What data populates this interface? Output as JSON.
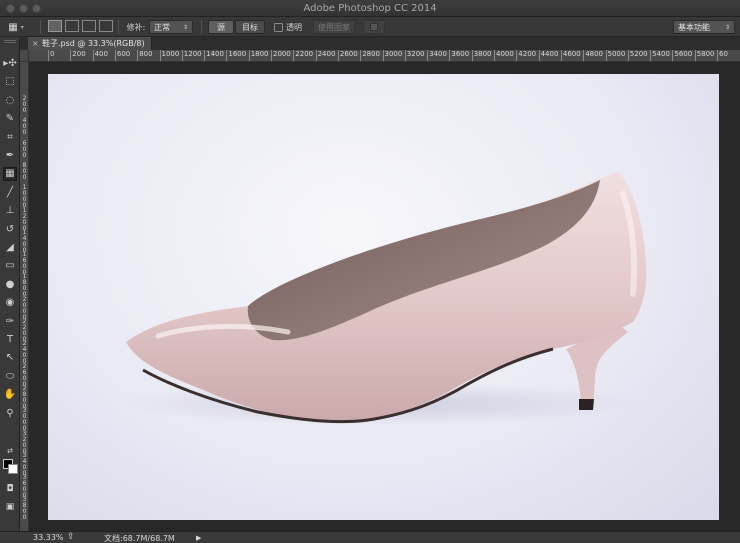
{
  "window": {
    "title": "Adobe Photoshop CC 2014"
  },
  "options_bar": {
    "patch_label": "修补:",
    "patch_mode": "正常",
    "source_button": "源",
    "target_button": "目标",
    "transparent_label": "透明",
    "use_pattern_button": "使用图案",
    "workspace": "基本功能"
  },
  "document": {
    "tab_title": "鞋子.psd @ 33.3%(RGB/8)",
    "close_glyph": "×"
  },
  "ruler": {
    "top_labels": [
      "0",
      "200",
      "400",
      "600",
      "800",
      "1000",
      "1200",
      "1400",
      "1600",
      "1800",
      "2000",
      "2200",
      "2400",
      "2600",
      "2800",
      "3000",
      "3200",
      "3400",
      "3600",
      "3800",
      "4000",
      "4200",
      "4400",
      "4600",
      "4800",
      "5000",
      "5200",
      "5400",
      "5600",
      "5800",
      "60"
    ],
    "left_labels": [
      "2 0 0",
      "4 0 0",
      "6 0 0",
      "8 0 0",
      "1 0 0 0",
      "1 2 0 0",
      "1 4 0 0",
      "1 6 0 0",
      "1 8 0 0",
      "2 0 0 0",
      "2 2 0 0",
      "2 4 0 0",
      "2 6 0 0",
      "2 8 0 0",
      "3 0 0 0",
      "3 2 0 0",
      "3 4 0 0",
      "3 6 0 0",
      "3 8 0 0"
    ]
  },
  "tools": [
    "move-icon",
    "marquee-icon",
    "lasso-icon",
    "quick-select-icon",
    "crop-icon",
    "eyedropper-icon",
    "patch-icon",
    "brush-icon",
    "stamp-icon",
    "history-brush-icon",
    "eraser-icon",
    "gradient-icon",
    "blur-icon",
    "dodge-icon",
    "pen-icon",
    "type-icon",
    "path-select-icon",
    "ellipse-icon",
    "hand-icon",
    "zoom-icon"
  ],
  "tool_glyphs": [
    "▸✣",
    "⬚",
    "◌",
    "✎",
    "⌗",
    "✒",
    "▦",
    "╱",
    "⊥",
    "↺",
    "◢",
    "▭",
    "●",
    "◉",
    "✑",
    "T",
    "↖",
    "⬭",
    "✋",
    "⚲"
  ],
  "colors": {
    "foreground": "#000000",
    "background": "#ffffff",
    "shoe": "#e6cfd0",
    "canvas_bg": "#eaeaf4"
  },
  "status": {
    "zoom": "33.33%",
    "doc_size": "文档:68.7M/68.7M",
    "arrow": "▶"
  }
}
